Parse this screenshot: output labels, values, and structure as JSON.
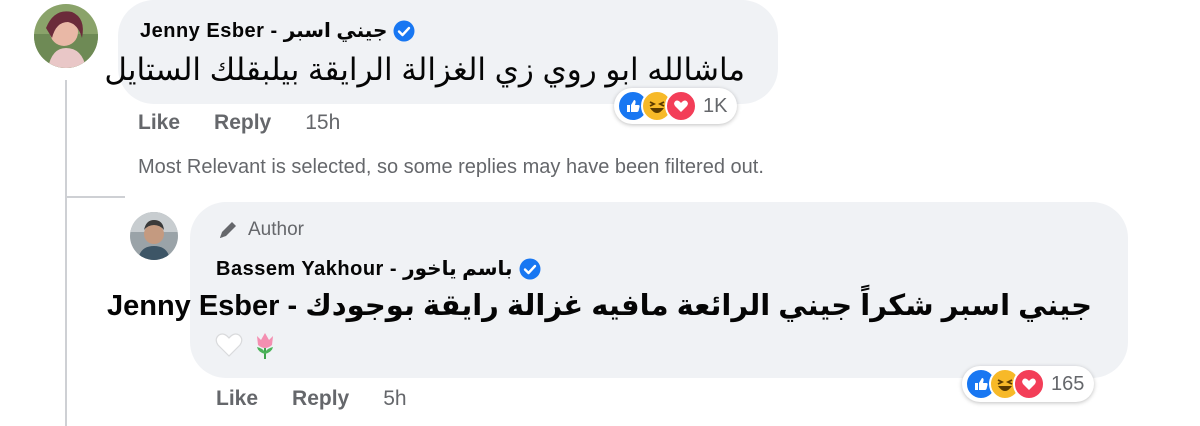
{
  "comment": {
    "author_name": "Jenny Esber - جيني اسبر",
    "text": "ماشالله ابو روي زي الغزالة الرايقة بيلبقلك الستايل",
    "like_label": "Like",
    "reply_label": "Reply",
    "time": "15h",
    "reaction_count": "1K",
    "reaction_icons": [
      "like-icon",
      "haha-icon",
      "love-icon"
    ]
  },
  "filter_notice": "Most Relevant is selected, so some replies may have been filtered out.",
  "reply": {
    "badge_label": "Author",
    "author_name": "Bassem Yakhour - باسم ياخور",
    "text_line1": "جيني اسبر شكراً جيني الرائعة مافيه غزالة رايقة بوجودك - Jenny Esber",
    "text_line2_icons": [
      "white-heart-icon",
      "tulip-icon"
    ],
    "like_label": "Like",
    "reply_label": "Reply",
    "time": "5h",
    "reaction_count": "165",
    "reaction_icons": [
      "like-icon",
      "haha-icon",
      "love-icon"
    ]
  },
  "colors": {
    "bubble": "#f0f2f5",
    "meta_text": "#65676b",
    "verified": "#1877f2",
    "like": "#1877f2",
    "haha": "#f7b928",
    "love": "#f33e58"
  }
}
